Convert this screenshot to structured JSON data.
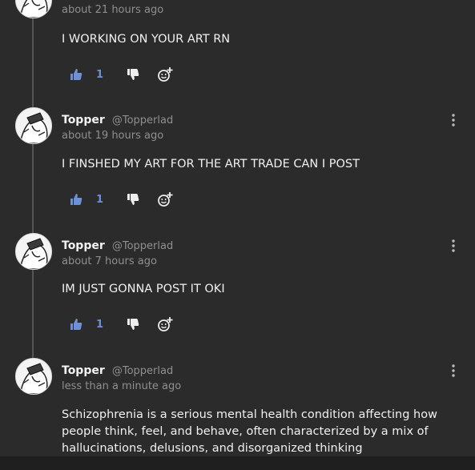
{
  "comments": [
    {
      "author": "",
      "handle": "",
      "timestamp": "about 21 hours ago",
      "body": "I WORKING ON YOUR ART RN",
      "votes": "1"
    },
    {
      "author": "Topper",
      "handle": "@Topperlad",
      "timestamp": "about 19 hours ago",
      "body": "I FINSHED MY ART FOR THE ART TRADE CAN I POST",
      "votes": "1"
    },
    {
      "author": "Topper",
      "handle": "@Topperlad",
      "timestamp": "about 7 hours ago",
      "body": "IM JUST GONNA POST IT OKI",
      "votes": "1"
    },
    {
      "author": "Topper",
      "handle": "@Topperlad",
      "timestamp": "less than a minute ago",
      "body": "Schizophrenia is a serious mental health condition affecting how people think, feel, and behave, often characterized by a mix of hallucinations, delusions, and disorganized thinking",
      "votes": ""
    }
  ],
  "icons": {
    "upvote": "thumbs-up-icon",
    "downvote": "thumbs-down-icon",
    "react": "add-emoji-icon",
    "menu": "more-vertical-icon"
  },
  "colors": {
    "background": "#2b2b2b",
    "vote_accent": "#6f8fd6",
    "muted_text": "#8f8f8f"
  }
}
